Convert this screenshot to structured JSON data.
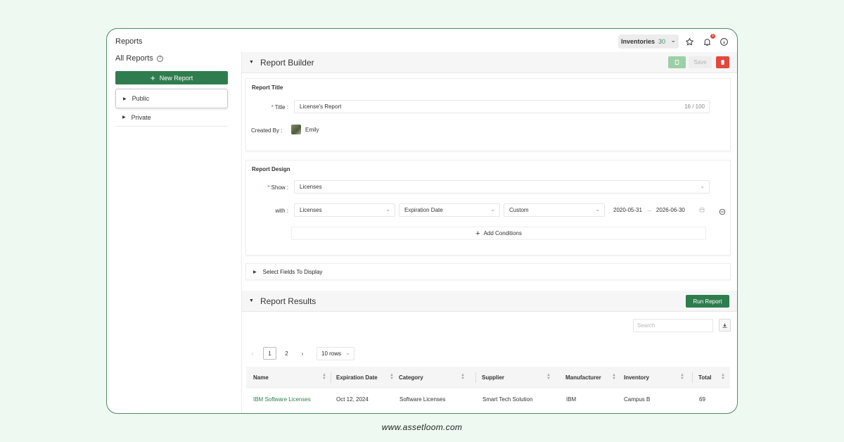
{
  "header": {
    "title": "Reports",
    "inventory_label": "Inventories",
    "inventory_count": "30",
    "notification_count": "1"
  },
  "sidebar": {
    "title": "All Reports",
    "new_report_label": "New Report",
    "items": [
      {
        "label": "Public"
      },
      {
        "label": "Private"
      }
    ]
  },
  "builder": {
    "title": "Report Builder",
    "save_label": "Save",
    "report_title_section": "Report Title",
    "title_label": "Title :",
    "title_value": "License's Report",
    "title_counter": "16 / 100",
    "created_by_label": "Created By :",
    "created_by_value": "Emily",
    "design_section": "Report Design",
    "show_label": "Show :",
    "show_value": "Licenses",
    "with_label": "with :",
    "with_entity": "Licenses",
    "with_field": "Expiration Date",
    "with_range_type": "Custom",
    "date_start": "2020-05-31",
    "date_end": "2026-06-30",
    "add_conditions_label": "Add Conditions",
    "select_fields_label": "Select Fields To Display"
  },
  "results": {
    "title": "Report Results",
    "run_label": "Run Report",
    "search_placeholder": "Search",
    "pages": [
      "1",
      "2"
    ],
    "rows_per_page": "10 rows",
    "columns": [
      "Name",
      "Expiration Date",
      "Category",
      "Supplier",
      "Manufacturer",
      "Inventory",
      "Total"
    ],
    "rows": [
      [
        "IBM Software Licenses",
        "Oct 12, 2024",
        "Software Licenses",
        "Smart Tech Solution",
        "IBM",
        "Campus B",
        "69"
      ]
    ]
  },
  "footer": {
    "url": "www.assetloom.com"
  },
  "colors": {
    "accent": "#2f7d4f",
    "danger": "#e5483c",
    "background": "#eef9f1"
  }
}
